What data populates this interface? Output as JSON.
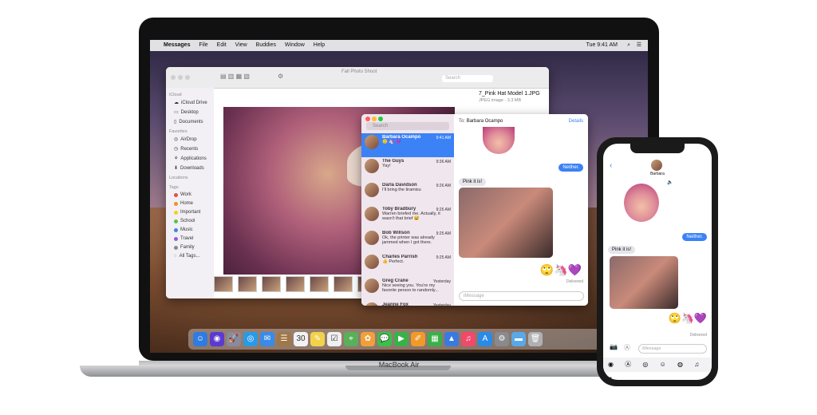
{
  "device_label": "MacBook Air",
  "menubar": {
    "app": "Messages",
    "items": [
      "File",
      "Edit",
      "View",
      "Buddies",
      "Window",
      "Help"
    ],
    "clock": "Tue 9:41 AM"
  },
  "finder": {
    "title": "Fall Photo Shoot",
    "search_placeholder": "Search",
    "sidebar": {
      "icloud_header": "iCloud",
      "icloud": [
        "iCloud Drive",
        "Desktop",
        "Documents"
      ],
      "favorites_header": "Favorites",
      "favorites": [
        "AirDrop",
        "Recents",
        "Applications",
        "Downloads"
      ],
      "locations_header": "Locations",
      "tags_header": "Tags",
      "tags": [
        {
          "label": "Work",
          "color": "#e0504a"
        },
        {
          "label": "Home",
          "color": "#f0902a"
        },
        {
          "label": "Important",
          "color": "#f2cf2a"
        },
        {
          "label": "School",
          "color": "#5fc24a"
        },
        {
          "label": "Music",
          "color": "#3a86e8"
        },
        {
          "label": "Travel",
          "color": "#9a5ad8"
        },
        {
          "label": "Family",
          "color": "#8a8a8e"
        },
        {
          "label": "All Tags...",
          "color": ""
        }
      ]
    },
    "file_info": {
      "name": "7_Pink Hat Model 1.JPG",
      "meta": "JPEG image - 3.3 MB"
    }
  },
  "messages_mac": {
    "search_placeholder": "Search",
    "to_label": "To:",
    "to_name": "Barbara Ocampo",
    "details": "Details",
    "conversations": [
      {
        "name": "Barbara Ocampo",
        "preview": "🙂 🦄 💜",
        "time": "9:41 AM",
        "selected": true
      },
      {
        "name": "The Guys",
        "preview": "Yay!",
        "time": "9:36 AM",
        "selected": false
      },
      {
        "name": "Darla Davidson",
        "preview": "I'll bring the tiramisu",
        "time": "9:26 AM",
        "selected": false
      },
      {
        "name": "Toby Bradbury",
        "preview": "Warren briefed me. Actually, it wasn't that brief 😅",
        "time": "9:25 AM",
        "selected": false
      },
      {
        "name": "Bob Willson",
        "preview": "Ok, the printer was already jammed when I got there.",
        "time": "9:25 AM",
        "selected": false
      },
      {
        "name": "Charles Parrish",
        "preview": "👍 Perfect.",
        "time": "9:25 AM",
        "selected": false
      },
      {
        "name": "Greg Crane",
        "preview": "Nice seeing you. You're my favorite person to randomly...",
        "time": "Yesterday",
        "selected": false
      },
      {
        "name": "Jeanne Fox",
        "preview": "Every meal I've had today has included bacon. #winning",
        "time": "Yesterday",
        "selected": false
      }
    ],
    "bubble_sent": "Neither.",
    "bubble_received": "Pink it is!",
    "delivered": "Delivered",
    "input_placeholder": "iMessage"
  },
  "iphone": {
    "contact": "Barbara",
    "bubble_sent": "Neither.",
    "bubble_received": "Pink it is!",
    "delivered": "Delivered",
    "input_placeholder": "iMessage",
    "emoji_reply": "🙄🦄💜"
  },
  "dock_icons": [
    {
      "name": "finder-icon",
      "glyph": "☺",
      "color": "#2f7be0"
    },
    {
      "name": "siri-icon",
      "glyph": "◉",
      "color": "#5a3ad0"
    },
    {
      "name": "launchpad-icon",
      "glyph": "🚀",
      "color": "#8a8a9a"
    },
    {
      "name": "safari-icon",
      "glyph": "◎",
      "color": "#2a9ae8"
    },
    {
      "name": "mail-icon",
      "glyph": "✉",
      "color": "#3a8ae8"
    },
    {
      "name": "contacts-icon",
      "glyph": "☰",
      "color": "#a07848"
    },
    {
      "name": "calendar-icon",
      "glyph": "30",
      "color": "#f2f2f2"
    },
    {
      "name": "notes-icon",
      "glyph": "✎",
      "color": "#f2d24a"
    },
    {
      "name": "reminders-icon",
      "glyph": "☑",
      "color": "#f0f0f0"
    },
    {
      "name": "maps-icon",
      "glyph": "⌖",
      "color": "#5ab05a"
    },
    {
      "name": "photos-icon",
      "glyph": "✿",
      "color": "#f0a03a"
    },
    {
      "name": "messages-icon",
      "glyph": "💬",
      "color": "#3ac04a"
    },
    {
      "name": "facetime-icon",
      "glyph": "▶",
      "color": "#3ab04a"
    },
    {
      "name": "pages-icon",
      "glyph": "✐",
      "color": "#f09a2a"
    },
    {
      "name": "numbers-icon",
      "glyph": "▦",
      "color": "#3ab04a"
    },
    {
      "name": "keynote-icon",
      "glyph": "▲",
      "color": "#3a7ae0"
    },
    {
      "name": "music-icon",
      "glyph": "♫",
      "color": "#f04a6a"
    },
    {
      "name": "app-store-icon",
      "glyph": "A",
      "color": "#2a8ae8"
    },
    {
      "name": "system-preferences-icon",
      "glyph": "⚙",
      "color": "#8a8a8e"
    },
    {
      "name": "folder-icon",
      "glyph": "▬",
      "color": "#5aa8e8"
    },
    {
      "name": "trash-icon",
      "glyph": "🗑",
      "color": "#b0b0b4"
    }
  ]
}
